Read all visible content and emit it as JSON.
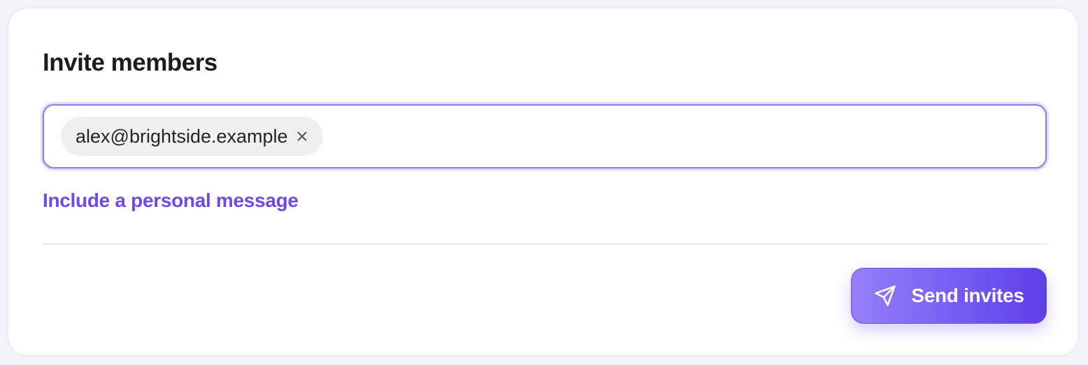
{
  "panel": {
    "title": "Invite members"
  },
  "invite_field": {
    "chips": [
      {
        "email": "alex@brightside.example",
        "remove_icon": "close-icon"
      }
    ],
    "input_value": "",
    "placeholder": ""
  },
  "personal_message_link": "Include a personal message",
  "send_button": {
    "label": "Send invites",
    "icon": "paper-plane-icon"
  },
  "colors": {
    "accent": "#6f4ae6",
    "field_border": "#8f77ee",
    "button_gradient_start": "#977ff8",
    "button_gradient_end": "#5f3ee8",
    "chip_background": "#f0f0f2",
    "title_text": "#1c1b22"
  }
}
